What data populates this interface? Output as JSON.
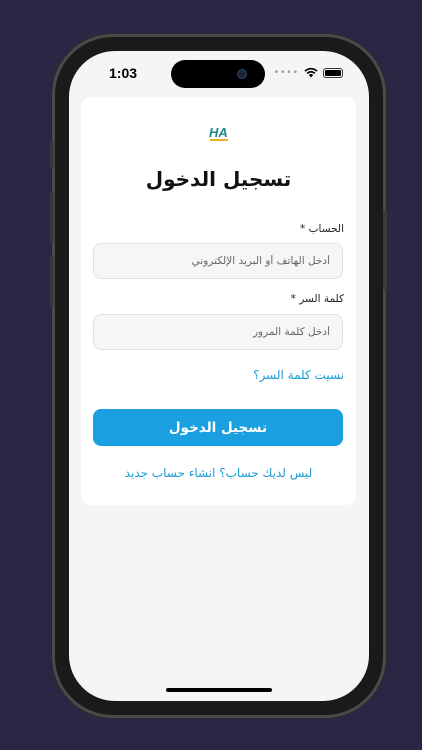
{
  "status_bar": {
    "time": "1:03",
    "dots": "••••",
    "wifi_icon": "wifi-icon",
    "battery_icon": "battery-icon"
  },
  "logo": {
    "text": "HA",
    "icon": "app-logo-icon"
  },
  "login": {
    "title": "تسجيل الدخول",
    "account_label": "الحساب",
    "account_required": "*",
    "account_placeholder": "أدخل الهاتف أو البريد الإلكتروني",
    "password_label": "كلمة السر",
    "password_required": "*",
    "password_placeholder": "أدخل كلمة المرور",
    "forgot_password": "نسيت كلمة السر؟",
    "submit_label": "تسجيل الدخول",
    "signup_prompt": "ليس لديك حساب؟ انشاء حساب جديد"
  },
  "colors": {
    "background": "#2b2644",
    "accent": "#1aa0e0",
    "link": "#1a9bd7"
  }
}
